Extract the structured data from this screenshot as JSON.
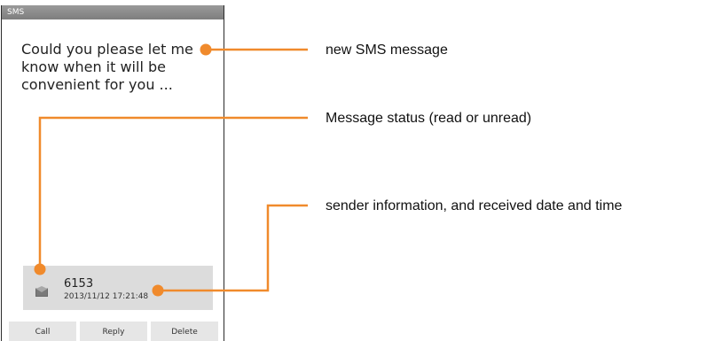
{
  "window": {
    "title": "SMS"
  },
  "message": {
    "body": "Could you please let me\nknow when it will be\nconvenient for you ..."
  },
  "sender": {
    "number": "6153",
    "received": "2013/11/12 17:21:48",
    "status_icon": "envelope-icon"
  },
  "buttons": {
    "call": "Call",
    "reply": "Reply",
    "delete": "Delete"
  },
  "callouts": {
    "new_sms": "new SMS message",
    "status": "Message status (read or unread)",
    "sender_info": "sender information, and received date and time"
  },
  "colors": {
    "callout": "#F08A2C",
    "titlebar": "#8C8C8C",
    "card": "#DCDCDC"
  }
}
